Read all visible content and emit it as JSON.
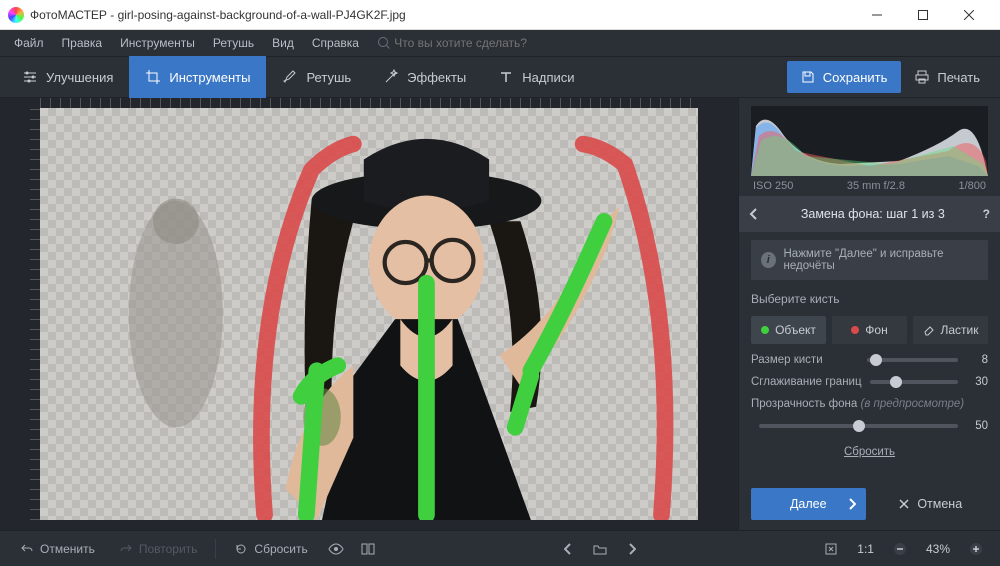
{
  "window": {
    "title": "ФотоМАСТЕР - girl-posing-against-background-of-a-wall-PJ4GK2F.jpg"
  },
  "menu": {
    "file": "Файл",
    "edit": "Правка",
    "tools": "Инструменты",
    "retouch": "Ретушь",
    "view": "Вид",
    "help": "Справка",
    "search_placeholder": "Что вы хотите сделать?"
  },
  "tabs": {
    "enhance": "Улучшения",
    "tools": "Инструменты",
    "retouch": "Ретушь",
    "effects": "Эффекты",
    "captions": "Надписи"
  },
  "actions": {
    "save": "Сохранить",
    "print": "Печать"
  },
  "exif": {
    "iso": "ISO 250",
    "focal": "35 mm f/2.8",
    "shutter": "1/800"
  },
  "panel": {
    "title": "Замена фона: шаг 1 из 3",
    "hint": "Нажмите \"Далее\" и исправьте недочёты",
    "choose_brush": "Выберите кисть",
    "brush_object": "Объект",
    "brush_bg": "Фон",
    "brush_eraser": "Ластик",
    "size_label": "Размер кисти",
    "size_value": "8",
    "smooth_label": "Сглаживание границ",
    "smooth_value": "30",
    "opacity_label": "Прозрачность фона",
    "opacity_hint": "(в предпросмотре)",
    "opacity_value": "50",
    "reset": "Сбросить",
    "next": "Далее",
    "cancel": "Отмена"
  },
  "bottom": {
    "undo": "Отменить",
    "redo": "Повторить",
    "reset": "Сбросить",
    "zoom_ratio": "1:1",
    "zoom_pct": "43%"
  }
}
